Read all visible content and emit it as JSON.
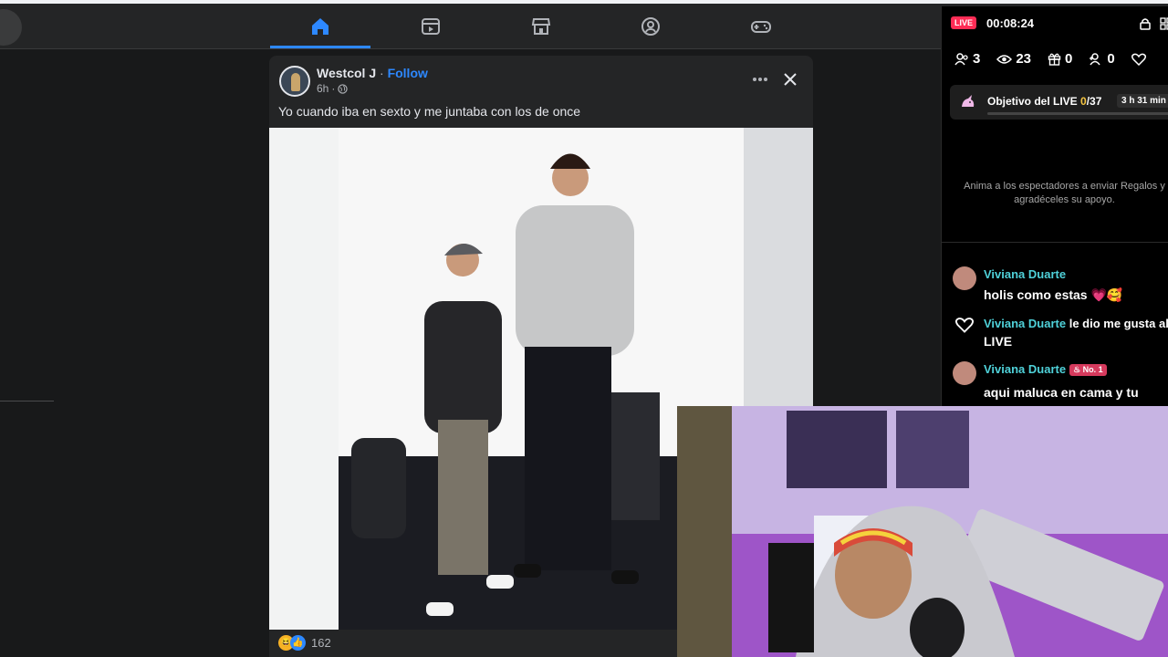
{
  "nav": {
    "tabs": [
      {
        "name": "home",
        "icon": "home-icon",
        "active": true
      },
      {
        "name": "watch",
        "icon": "video-icon",
        "active": false
      },
      {
        "name": "marketplace",
        "icon": "store-icon",
        "active": false
      },
      {
        "name": "groups",
        "icon": "groups-icon",
        "active": false
      },
      {
        "name": "gaming",
        "icon": "gamepad-icon",
        "active": false
      }
    ],
    "accent": "#2d88ff"
  },
  "post": {
    "author": "Westcol J",
    "separator": "·",
    "follow_label": "Follow",
    "time": "6h",
    "caption": "Yo cuando iba en sexto y me juntaba con los de once",
    "reaction_count": "162"
  },
  "live": {
    "badge": "LIVE",
    "timer": "00:08:24",
    "stats": {
      "members": "3",
      "viewers": "23",
      "gifts": "0",
      "new_followers": "0"
    },
    "goal": {
      "title": "Objetivo del LIVE ",
      "count_current": "0",
      "count_total": "/37",
      "time_left": "3 h 31 min"
    },
    "encourage_text": "Anima a los espectadores a enviar Regalos y agradéceles su apoyo.",
    "chat": [
      {
        "name": "Viviana Duarte",
        "text": "holis como estas 💗🥰",
        "badge": ""
      },
      {
        "name": "Viviana Duarte",
        "text": "le dio me gusta al",
        "text2": "LIVE",
        "badge": ""
      },
      {
        "name": "Viviana Duarte",
        "text": "aqui maluca en cama y tu",
        "badge": "No. 1"
      }
    ]
  }
}
